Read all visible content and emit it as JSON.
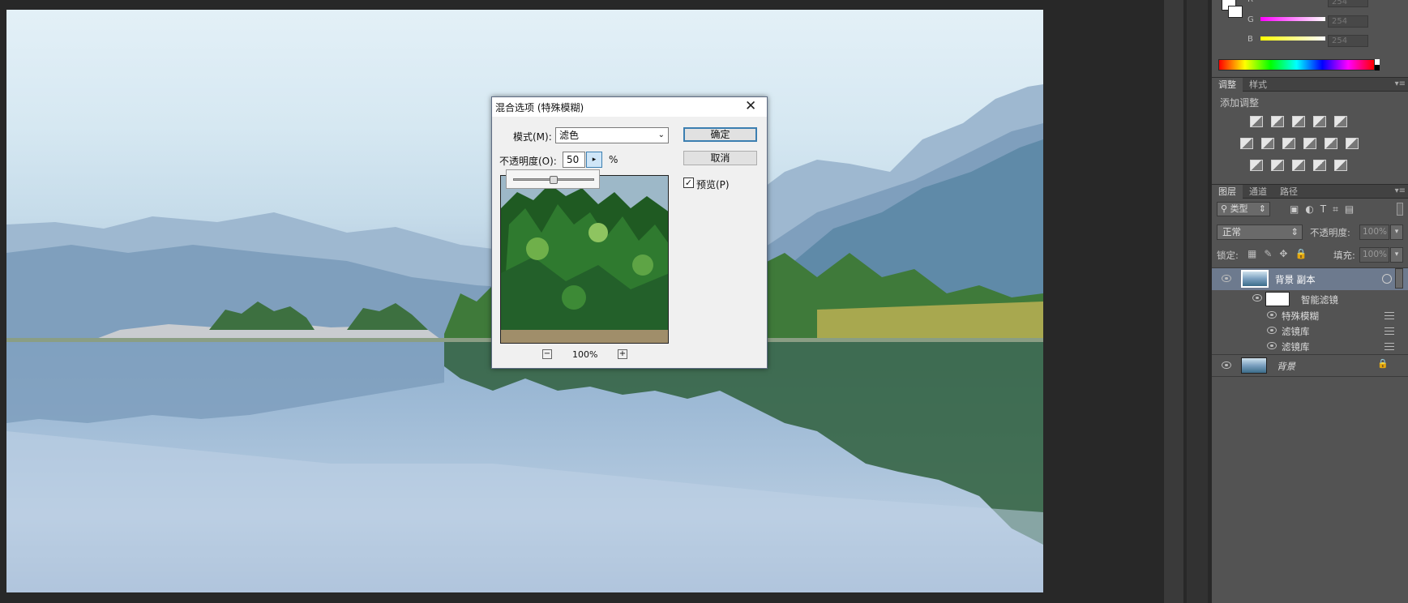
{
  "colors": {
    "workspace": "#282828",
    "panel": "#535353",
    "dialog_bg": "#f0f0f0",
    "accent": "#3c7fb1"
  },
  "color_panel": {
    "channels": [
      {
        "label": "R",
        "value": "254"
      },
      {
        "label": "G",
        "value": "254"
      },
      {
        "label": "B",
        "value": "254"
      }
    ]
  },
  "adjust_panel": {
    "tabs": [
      "调整",
      "样式"
    ],
    "heading": "添加调整"
  },
  "layers_panel": {
    "tabs": [
      "图层",
      "通道",
      "路径"
    ],
    "filter_kind": "类型",
    "blend_mode": "正常",
    "opacity_label": "不透明度:",
    "opacity_value": "100%",
    "lock_label": "锁定:",
    "fill_label": "填充:",
    "fill_value": "100%",
    "layers": [
      {
        "name": "背景 副本"
      },
      {
        "name": "智能滤镜"
      },
      {
        "name": "特殊模糊"
      },
      {
        "name": "滤镜库"
      },
      {
        "name": "滤镜库"
      },
      {
        "name": "背景"
      }
    ]
  },
  "dialog": {
    "title": "混合选项 (特殊模糊)",
    "mode_label": "模式(M):",
    "mode_value": "滤色",
    "opacity_label": "不透明度(O):",
    "opacity_value": "50",
    "percent_sign": "%",
    "ok_label": "确定",
    "cancel_label": "取消",
    "preview_label": "预览(P)",
    "preview_checked": true,
    "zoom": "100%",
    "slider_fraction": 0.5
  }
}
